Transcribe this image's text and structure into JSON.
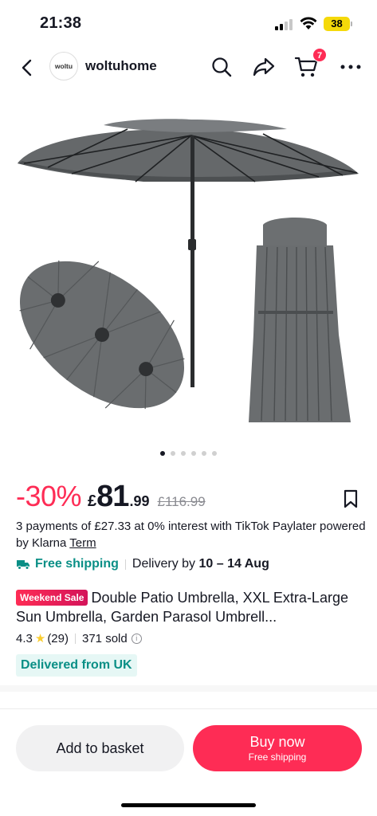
{
  "status_bar": {
    "time": "21:38",
    "battery": "38"
  },
  "header": {
    "store_logo_text": "woltu",
    "store_name": "woltuhome",
    "cart_count": "7"
  },
  "gallery": {
    "image_count": 6,
    "active_index": 0
  },
  "price": {
    "discount": "-30%",
    "currency": "£",
    "main": "81",
    "decimals": ".99",
    "original": "£116.99"
  },
  "paylater": {
    "text": "3 payments of  £27.33 at 0% interest with TikTok Paylater powered by Klarna",
    "term_link": "Term"
  },
  "shipping": {
    "free_label": "Free shipping",
    "delivery_prefix": "Delivery by",
    "delivery_dates": "10 – 14 Aug"
  },
  "product": {
    "sale_badge": "Weekend Sale",
    "title": "Double Patio Umbrella, XXL Extra-Large Sun Umbrella, Garden  Parasol  Umbrell..."
  },
  "rating": {
    "value": "4.3",
    "star": "★",
    "count": "(29)",
    "sold": "371 sold"
  },
  "origin_tag": "Delivered from UK",
  "actions": {
    "add_to_basket": "Add to basket",
    "buy_now": "Buy now",
    "buy_now_sub": "Free shipping"
  }
}
